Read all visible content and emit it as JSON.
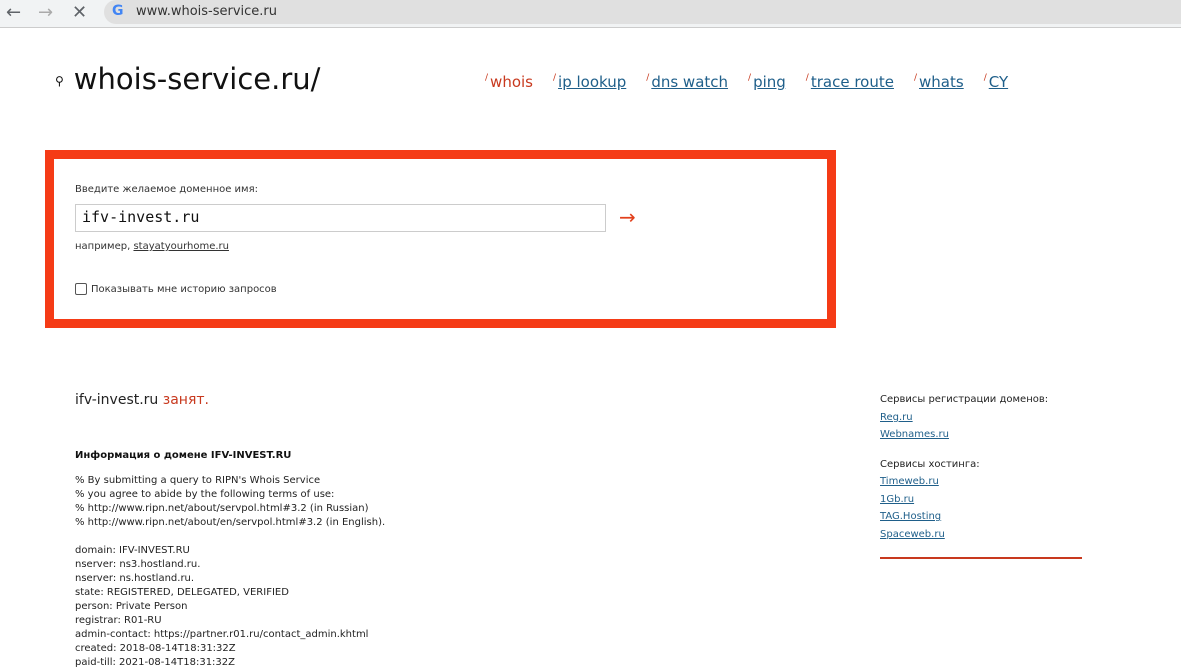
{
  "browser": {
    "url": "www.whois-service.ru"
  },
  "header": {
    "logo": "whois-service.ru/",
    "nav": [
      {
        "label": "whois",
        "active": true
      },
      {
        "label": "ip lookup"
      },
      {
        "label": "dns watch"
      },
      {
        "label": "ping"
      },
      {
        "label": "trace route"
      },
      {
        "label": "whats"
      },
      {
        "label": "CY"
      }
    ]
  },
  "form": {
    "label": "Введите желаемое доменное имя:",
    "value": "ifv-invest.ru",
    "submit": "→",
    "example_prefix": "например,",
    "example_link": "stayatyourhome.ru",
    "history_label": "Показывать мне историю запросов",
    "history_checked": false
  },
  "result": {
    "domain": "ifv-invest.ru",
    "status": "занят.",
    "info_heading": "Информация о домене IFV-INVEST.RU",
    "lines": [
      "% By submitting a query to RIPN's Whois Service",
      "% you agree to abide by the following terms of use:",
      "% http://www.ripn.net/about/servpol.html#3.2 (in Russian)",
      "% http://www.ripn.net/about/en/servpol.html#3.2 (in English).",
      "",
      "domain: IFV-INVEST.RU",
      "nserver: ns3.hostland.ru.",
      "nserver: ns.hostland.ru.",
      "state: REGISTERED, DELEGATED, VERIFIED",
      "person: Private Person",
      "registrar: R01-RU",
      "admin-contact: https://partner.r01.ru/contact_admin.khtml",
      "created: 2018-08-14T18:31:32Z",
      "paid-till: 2021-08-14T18:31:32Z"
    ]
  },
  "sidebar": {
    "reg_title": "Сервисы регистрации доменов:",
    "reg_links": [
      "Reg.ru",
      "Webnames.ru"
    ],
    "host_title": "Сервисы хостинга:",
    "host_links": [
      "Timeweb.ru",
      "1Gb.ru",
      "TAG.Hosting",
      "Spaceweb.ru"
    ]
  }
}
